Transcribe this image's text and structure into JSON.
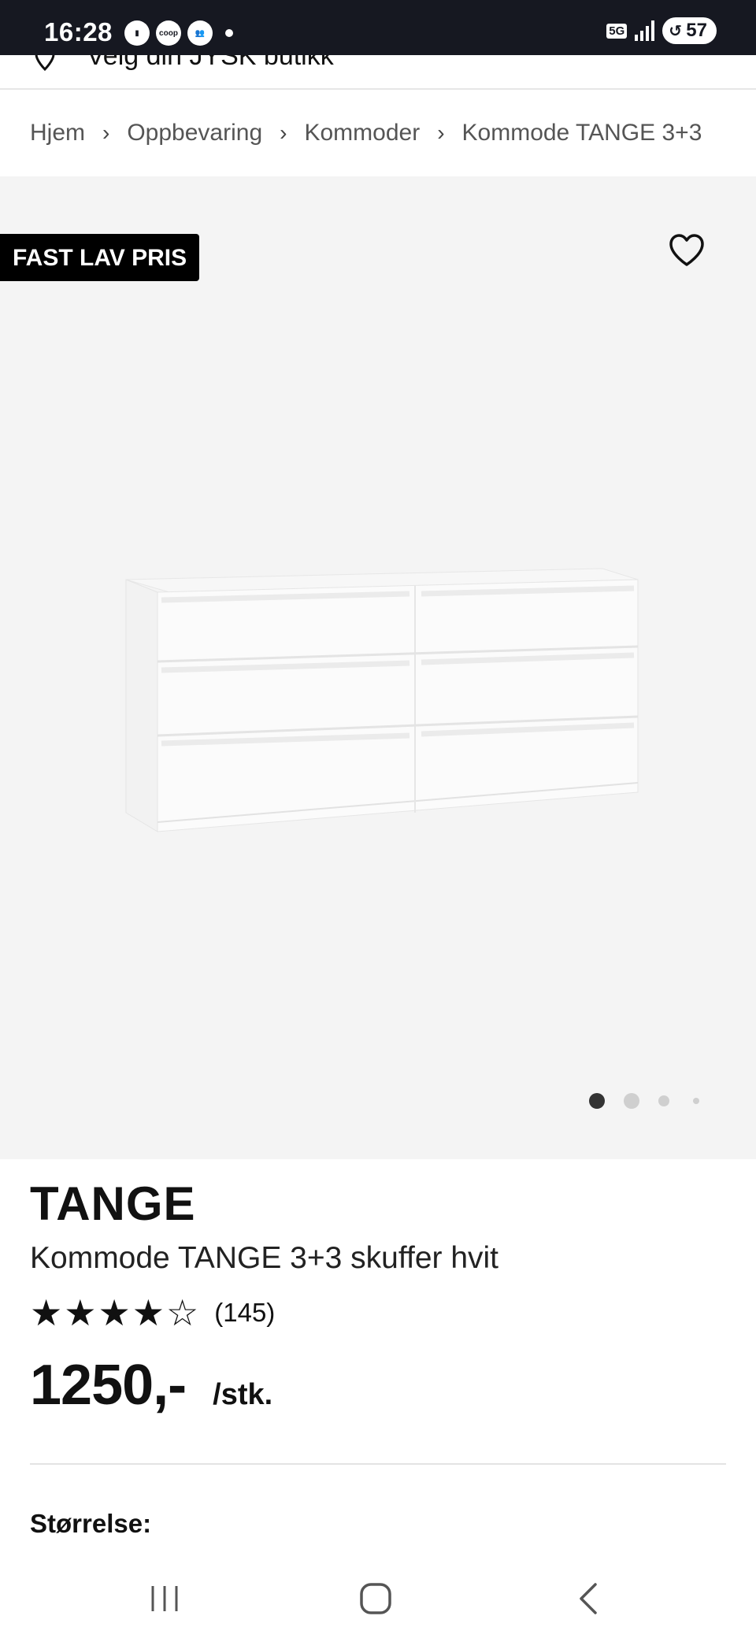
{
  "status_bar": {
    "time": "16:28",
    "network": "5G",
    "battery": "57"
  },
  "store_bar": {
    "text": "Velg din JYSK butikk"
  },
  "breadcrumb": {
    "items": [
      "Hjem",
      "Oppbevaring",
      "Kommoder",
      "Kommode TANGE 3+3"
    ]
  },
  "gallery": {
    "badge": "FAST LAV PRIS",
    "image_count": 4,
    "active_index": 0
  },
  "product": {
    "brand": "TANGE",
    "name": "Kommode TANGE 3+3 skuffer hvit",
    "rating": 4,
    "rating_max": 5,
    "review_count": "(145)",
    "price": "1250,-",
    "unit": "/stk."
  },
  "size": {
    "label": "Størrelse:"
  },
  "colors": {
    "status_bar_bg": "#161821",
    "badge_bg": "#000000",
    "gallery_bg": "#f4f4f4"
  }
}
